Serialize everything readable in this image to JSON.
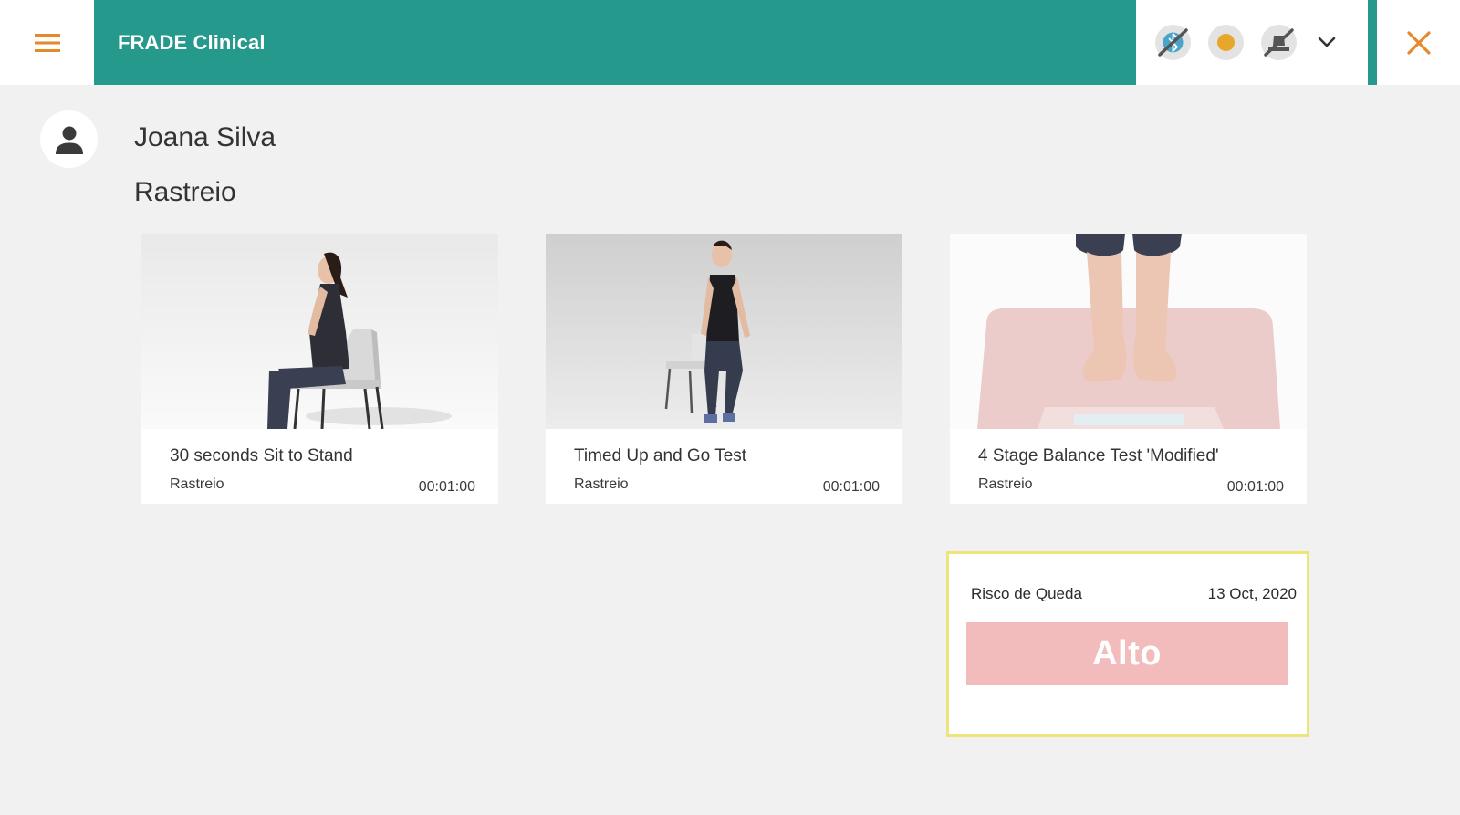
{
  "header": {
    "app_title": "FRADE Clinical",
    "menu_icon": "hamburger-menu-icon",
    "status_icons": [
      "bluetooth-off-icon",
      "status-dot-icon",
      "scale-off-icon"
    ],
    "expand_icon": "chevron-down-icon",
    "close_icon": "close-icon"
  },
  "colors": {
    "accent": "#25998c",
    "orange": "#e6892a",
    "risk_border": "#ede57a",
    "risk_high": "#f2bcbd"
  },
  "patient": {
    "name": "Joana Silva",
    "avatar_icon": "person-icon"
  },
  "section": {
    "title": "Rastreio"
  },
  "tests": [
    {
      "title": "30 seconds Sit to Stand",
      "category": "Rastreio",
      "duration": "00:01:00"
    },
    {
      "title": "Timed Up and Go Test",
      "category": "Rastreio",
      "duration": "00:01:00"
    },
    {
      "title": "4 Stage Balance Test 'Modified'",
      "category": "Rastreio",
      "duration": "00:01:00"
    }
  ],
  "risk": {
    "label": "Risco de Queda",
    "date": "13 Oct, 2020",
    "level": "Alto"
  }
}
